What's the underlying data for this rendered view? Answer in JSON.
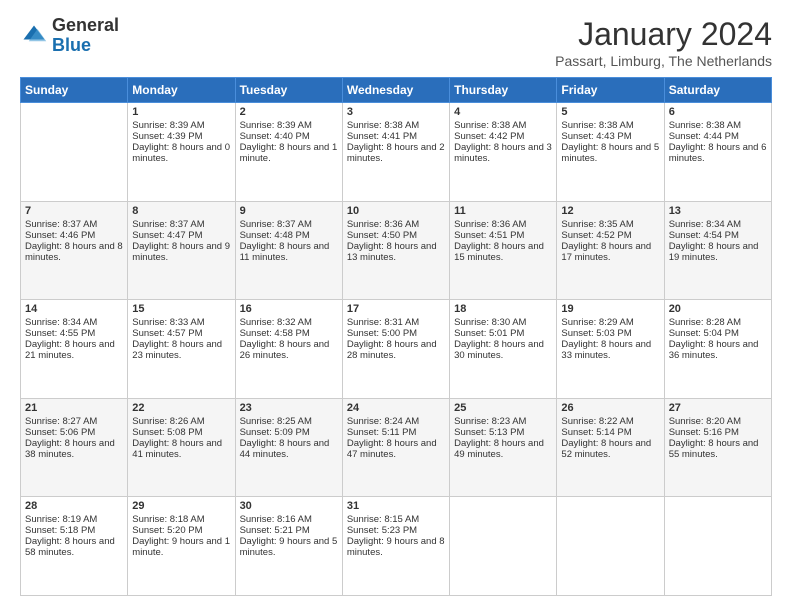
{
  "logo": {
    "general": "General",
    "blue": "Blue"
  },
  "header": {
    "month": "January 2024",
    "location": "Passart, Limburg, The Netherlands"
  },
  "weekdays": [
    "Sunday",
    "Monday",
    "Tuesday",
    "Wednesday",
    "Thursday",
    "Friday",
    "Saturday"
  ],
  "weeks": [
    [
      {
        "day": "",
        "sunrise": "",
        "sunset": "",
        "daylight": ""
      },
      {
        "day": "1",
        "sunrise": "Sunrise: 8:39 AM",
        "sunset": "Sunset: 4:39 PM",
        "daylight": "Daylight: 8 hours and 0 minutes."
      },
      {
        "day": "2",
        "sunrise": "Sunrise: 8:39 AM",
        "sunset": "Sunset: 4:40 PM",
        "daylight": "Daylight: 8 hours and 1 minute."
      },
      {
        "day": "3",
        "sunrise": "Sunrise: 8:38 AM",
        "sunset": "Sunset: 4:41 PM",
        "daylight": "Daylight: 8 hours and 2 minutes."
      },
      {
        "day": "4",
        "sunrise": "Sunrise: 8:38 AM",
        "sunset": "Sunset: 4:42 PM",
        "daylight": "Daylight: 8 hours and 3 minutes."
      },
      {
        "day": "5",
        "sunrise": "Sunrise: 8:38 AM",
        "sunset": "Sunset: 4:43 PM",
        "daylight": "Daylight: 8 hours and 5 minutes."
      },
      {
        "day": "6",
        "sunrise": "Sunrise: 8:38 AM",
        "sunset": "Sunset: 4:44 PM",
        "daylight": "Daylight: 8 hours and 6 minutes."
      }
    ],
    [
      {
        "day": "7",
        "sunrise": "Sunrise: 8:37 AM",
        "sunset": "Sunset: 4:46 PM",
        "daylight": "Daylight: 8 hours and 8 minutes."
      },
      {
        "day": "8",
        "sunrise": "Sunrise: 8:37 AM",
        "sunset": "Sunset: 4:47 PM",
        "daylight": "Daylight: 8 hours and 9 minutes."
      },
      {
        "day": "9",
        "sunrise": "Sunrise: 8:37 AM",
        "sunset": "Sunset: 4:48 PM",
        "daylight": "Daylight: 8 hours and 11 minutes."
      },
      {
        "day": "10",
        "sunrise": "Sunrise: 8:36 AM",
        "sunset": "Sunset: 4:50 PM",
        "daylight": "Daylight: 8 hours and 13 minutes."
      },
      {
        "day": "11",
        "sunrise": "Sunrise: 8:36 AM",
        "sunset": "Sunset: 4:51 PM",
        "daylight": "Daylight: 8 hours and 15 minutes."
      },
      {
        "day": "12",
        "sunrise": "Sunrise: 8:35 AM",
        "sunset": "Sunset: 4:52 PM",
        "daylight": "Daylight: 8 hours and 17 minutes."
      },
      {
        "day": "13",
        "sunrise": "Sunrise: 8:34 AM",
        "sunset": "Sunset: 4:54 PM",
        "daylight": "Daylight: 8 hours and 19 minutes."
      }
    ],
    [
      {
        "day": "14",
        "sunrise": "Sunrise: 8:34 AM",
        "sunset": "Sunset: 4:55 PM",
        "daylight": "Daylight: 8 hours and 21 minutes."
      },
      {
        "day": "15",
        "sunrise": "Sunrise: 8:33 AM",
        "sunset": "Sunset: 4:57 PM",
        "daylight": "Daylight: 8 hours and 23 minutes."
      },
      {
        "day": "16",
        "sunrise": "Sunrise: 8:32 AM",
        "sunset": "Sunset: 4:58 PM",
        "daylight": "Daylight: 8 hours and 26 minutes."
      },
      {
        "day": "17",
        "sunrise": "Sunrise: 8:31 AM",
        "sunset": "Sunset: 5:00 PM",
        "daylight": "Daylight: 8 hours and 28 minutes."
      },
      {
        "day": "18",
        "sunrise": "Sunrise: 8:30 AM",
        "sunset": "Sunset: 5:01 PM",
        "daylight": "Daylight: 8 hours and 30 minutes."
      },
      {
        "day": "19",
        "sunrise": "Sunrise: 8:29 AM",
        "sunset": "Sunset: 5:03 PM",
        "daylight": "Daylight: 8 hours and 33 minutes."
      },
      {
        "day": "20",
        "sunrise": "Sunrise: 8:28 AM",
        "sunset": "Sunset: 5:04 PM",
        "daylight": "Daylight: 8 hours and 36 minutes."
      }
    ],
    [
      {
        "day": "21",
        "sunrise": "Sunrise: 8:27 AM",
        "sunset": "Sunset: 5:06 PM",
        "daylight": "Daylight: 8 hours and 38 minutes."
      },
      {
        "day": "22",
        "sunrise": "Sunrise: 8:26 AM",
        "sunset": "Sunset: 5:08 PM",
        "daylight": "Daylight: 8 hours and 41 minutes."
      },
      {
        "day": "23",
        "sunrise": "Sunrise: 8:25 AM",
        "sunset": "Sunset: 5:09 PM",
        "daylight": "Daylight: 8 hours and 44 minutes."
      },
      {
        "day": "24",
        "sunrise": "Sunrise: 8:24 AM",
        "sunset": "Sunset: 5:11 PM",
        "daylight": "Daylight: 8 hours and 47 minutes."
      },
      {
        "day": "25",
        "sunrise": "Sunrise: 8:23 AM",
        "sunset": "Sunset: 5:13 PM",
        "daylight": "Daylight: 8 hours and 49 minutes."
      },
      {
        "day": "26",
        "sunrise": "Sunrise: 8:22 AM",
        "sunset": "Sunset: 5:14 PM",
        "daylight": "Daylight: 8 hours and 52 minutes."
      },
      {
        "day": "27",
        "sunrise": "Sunrise: 8:20 AM",
        "sunset": "Sunset: 5:16 PM",
        "daylight": "Daylight: 8 hours and 55 minutes."
      }
    ],
    [
      {
        "day": "28",
        "sunrise": "Sunrise: 8:19 AM",
        "sunset": "Sunset: 5:18 PM",
        "daylight": "Daylight: 8 hours and 58 minutes."
      },
      {
        "day": "29",
        "sunrise": "Sunrise: 8:18 AM",
        "sunset": "Sunset: 5:20 PM",
        "daylight": "Daylight: 9 hours and 1 minute."
      },
      {
        "day": "30",
        "sunrise": "Sunrise: 8:16 AM",
        "sunset": "Sunset: 5:21 PM",
        "daylight": "Daylight: 9 hours and 5 minutes."
      },
      {
        "day": "31",
        "sunrise": "Sunrise: 8:15 AM",
        "sunset": "Sunset: 5:23 PM",
        "daylight": "Daylight: 9 hours and 8 minutes."
      },
      {
        "day": "",
        "sunrise": "",
        "sunset": "",
        "daylight": ""
      },
      {
        "day": "",
        "sunrise": "",
        "sunset": "",
        "daylight": ""
      },
      {
        "day": "",
        "sunrise": "",
        "sunset": "",
        "daylight": ""
      }
    ]
  ]
}
